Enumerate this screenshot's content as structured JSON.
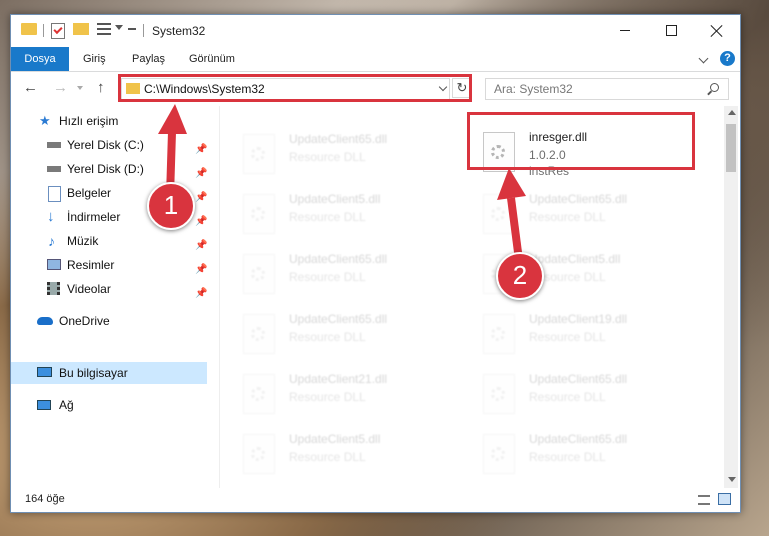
{
  "window": {
    "title": "System32"
  },
  "ribbon": {
    "tabs": [
      "Dosya",
      "Giriş",
      "Paylaş",
      "Görünüm"
    ],
    "help": "?"
  },
  "address": {
    "path": "C:\\Windows\\System32"
  },
  "search": {
    "placeholder": "Ara: System32"
  },
  "sidebar": {
    "items": [
      {
        "label": "Hızlı erişim",
        "icon": "star-icon"
      },
      {
        "label": "Yerel Disk (C:)",
        "icon": "drive-icon",
        "pinned": true
      },
      {
        "label": "Yerel Disk (D:)",
        "icon": "drive-icon",
        "pinned": true
      },
      {
        "label": "Belgeler",
        "icon": "documents-icon",
        "pinned": true
      },
      {
        "label": "İndirmeler",
        "icon": "download-icon",
        "pinned": true
      },
      {
        "label": "Müzik",
        "icon": "music-icon",
        "pinned": true
      },
      {
        "label": "Resimler",
        "icon": "pictures-icon",
        "pinned": true
      },
      {
        "label": "Videolar",
        "icon": "videos-icon",
        "pinned": true
      },
      {
        "label": "OneDrive",
        "icon": "cloud-icon"
      },
      {
        "label": "Bu bilgisayar",
        "icon": "computer-icon",
        "selected": true
      },
      {
        "label": "Ağ",
        "icon": "network-icon"
      }
    ]
  },
  "files": {
    "highlighted": {
      "name": "inresger.dll",
      "version": "1.0.2.0",
      "description": "instRes"
    },
    "left": [
      {
        "name": "UpdateClient65.dll",
        "type": "Resource DLL"
      },
      {
        "name": "UpdateClient5.dll",
        "type": "Resource DLL"
      },
      {
        "name": "UpdateClient65.dll",
        "type": "Resource DLL"
      },
      {
        "name": "UpdateClient65.dll",
        "type": "Resource DLL"
      },
      {
        "name": "UpdateClient21.dll",
        "type": "Resource DLL"
      },
      {
        "name": "UpdateClient5.dll",
        "type": "Resource DLL"
      }
    ],
    "right": [
      {
        "name": "UpdateClient65.dll",
        "type": "Resource DLL"
      },
      {
        "name": "UpdateClient5.dll",
        "type": "Resource DLL"
      },
      {
        "name": "UpdateClient19.dll",
        "type": "Resource DLL"
      },
      {
        "name": "UpdateClient65.dll",
        "type": "Resource DLL"
      },
      {
        "name": "UpdateClient65.dll",
        "type": "Resource DLL"
      }
    ]
  },
  "status": {
    "count": "164 öğe"
  },
  "callouts": {
    "one": "1",
    "two": "2"
  },
  "colors": {
    "accent": "#1979ca",
    "highlight": "#d9343e",
    "selected": "#cce8ff"
  }
}
